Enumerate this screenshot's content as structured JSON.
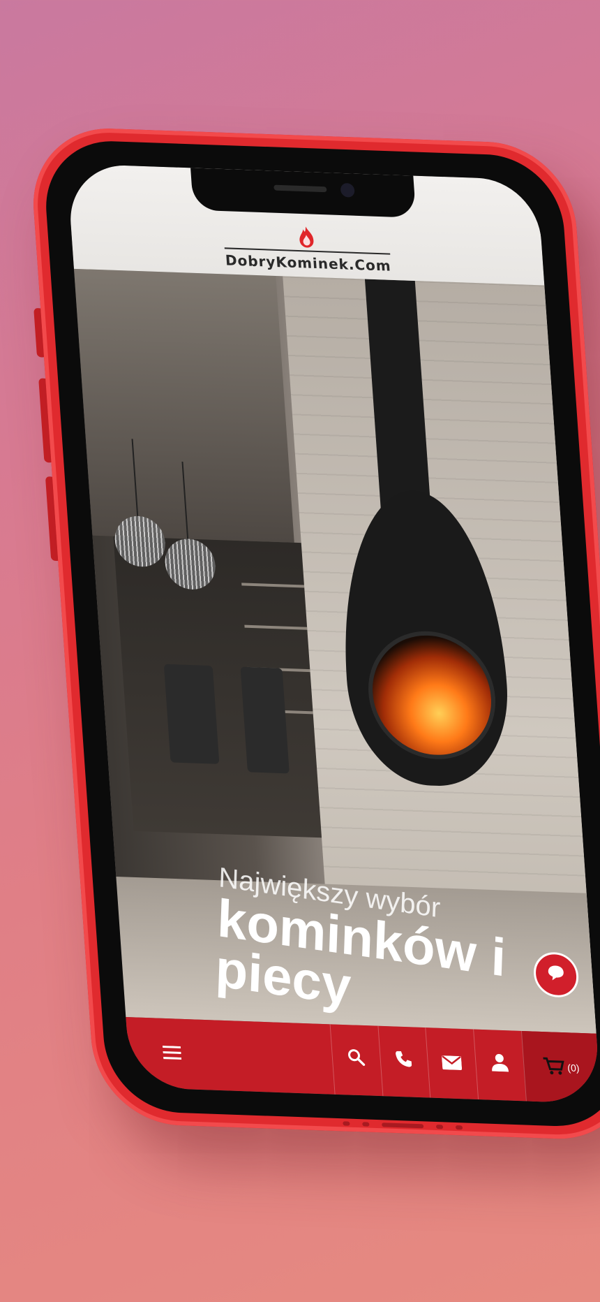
{
  "site": {
    "logo_text": "DobryKominek.Com"
  },
  "hero": {
    "subtitle": "Największy wybór",
    "title_line1": "kominków i",
    "title_line2": "piecy"
  },
  "nav": {
    "menu_icon": "menu-icon",
    "search_icon": "search-icon",
    "phone_icon": "phone-icon",
    "mail_icon": "mail-icon",
    "user_icon": "user-icon",
    "cart_icon": "cart-icon",
    "cart_count": "(0)"
  },
  "chat": {
    "icon": "chat-bubble-icon"
  },
  "colors": {
    "brand_red": "#c41d26",
    "phone_red": "#e02a2e",
    "background_pink": "#d77a92"
  }
}
